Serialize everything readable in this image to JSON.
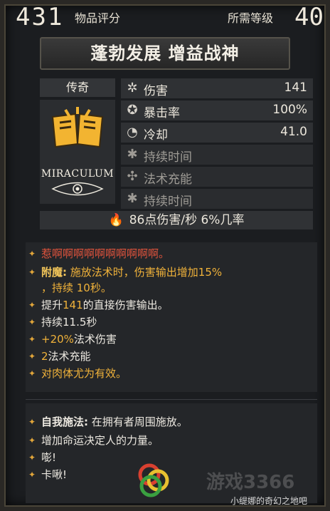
{
  "header": {
    "score": "431",
    "score_label": "物品评分",
    "req_label": "所需等级",
    "req_value": "40"
  },
  "item": {
    "name": "蓬勃发展 增益战神",
    "rarity": "传奇",
    "brand": "MIRACULUM"
  },
  "stats": [
    {
      "icon": "damage-icon",
      "name": "伤害",
      "value": "141"
    },
    {
      "icon": "crit-icon",
      "name": "暴击率",
      "value": "100%"
    },
    {
      "icon": "cooldown-icon",
      "name": "冷却",
      "value": "41.0"
    },
    {
      "icon": "duration-icon",
      "name": "持续时间",
      "value": ""
    },
    {
      "icon": "charge-icon",
      "name": "法术充能",
      "value": ""
    },
    {
      "icon": "duration-icon",
      "name": "持续时间",
      "value": ""
    }
  ],
  "dps": "86点伤害/秒  6%几率",
  "effects": {
    "line1": "惹啊啊啊啊啊啊啊啊啊啊。",
    "enchant_label": "附魔:",
    "enchant_text": "施放法术时，伤害输出增加15%",
    "enchant_text2": "，持续 10秒。",
    "line3a": "提升",
    "line3b": "141",
    "line3c": "的直接伤害输出。",
    "line4": "持续11.5秒",
    "line5a": "+20%",
    "line5b": "法术伤害",
    "line6a": "2",
    "line6b": "法术充能",
    "line7": "对肉体尤为有效。"
  },
  "self_cast": {
    "label": "自我施法:",
    "text": "在拥有者周围施放。",
    "line2": "增加命运决定人的力量。",
    "line3": "嘭!",
    "line4": "卡啾!"
  },
  "watermark": {
    "site": "游戏3366",
    "user": "小缇娜的奇幻之地吧"
  },
  "colors": {
    "accent_gold": "#f0b23a",
    "red_text": "#e0533c"
  }
}
